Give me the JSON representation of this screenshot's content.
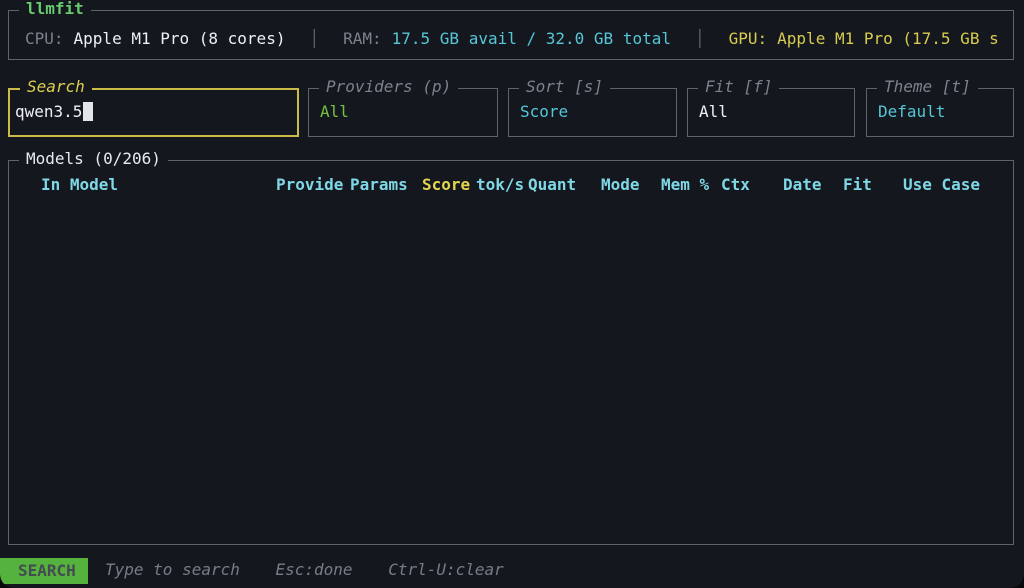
{
  "app": {
    "title": "llmfit"
  },
  "system": {
    "cpu_label": "CPU:",
    "cpu_value": "Apple M1 Pro (8 cores)",
    "separator": "│",
    "ram_label": "RAM:",
    "ram_value": "17.5 GB avail / 32.0 GB total",
    "gpu_label": "GPU:",
    "gpu_value": "Apple M1 Pro (17.5 GB s"
  },
  "filters": {
    "search": {
      "title": "Search",
      "value": "qwen3.5"
    },
    "providers": {
      "title": "Providers (p)",
      "value": "All"
    },
    "sort": {
      "title": "Sort [s]",
      "value": "Score"
    },
    "fit": {
      "title": "Fit [f]",
      "value": "All"
    },
    "theme": {
      "title": "Theme [t]",
      "value": "Default"
    }
  },
  "models": {
    "title": "Models (0/206)",
    "count_shown": 0,
    "count_total": 206,
    "sort_column": "Score",
    "columns": [
      "In Model",
      "Provide",
      "Params",
      "Score",
      "tok/s",
      "Quant",
      "Mode",
      "Mem %",
      "Ctx",
      "Date",
      "Fit",
      "Use Case"
    ],
    "rows": []
  },
  "statusbar": {
    "mode": "SEARCH",
    "hints": [
      "Type to search",
      "Esc:done",
      "Ctrl-U:clear"
    ]
  },
  "colors": {
    "background": "#14171e",
    "border_gray": "#5d646e",
    "accent_yellow": "#d8cc4f",
    "accent_cyan": "#56c7d8",
    "header_cyan": "#7fd8e6",
    "title_green": "#68cb70",
    "value_green": "#76c342",
    "badge_green": "#54b23d",
    "muted_gray": "#7b828c",
    "white": "#eef1f4"
  }
}
